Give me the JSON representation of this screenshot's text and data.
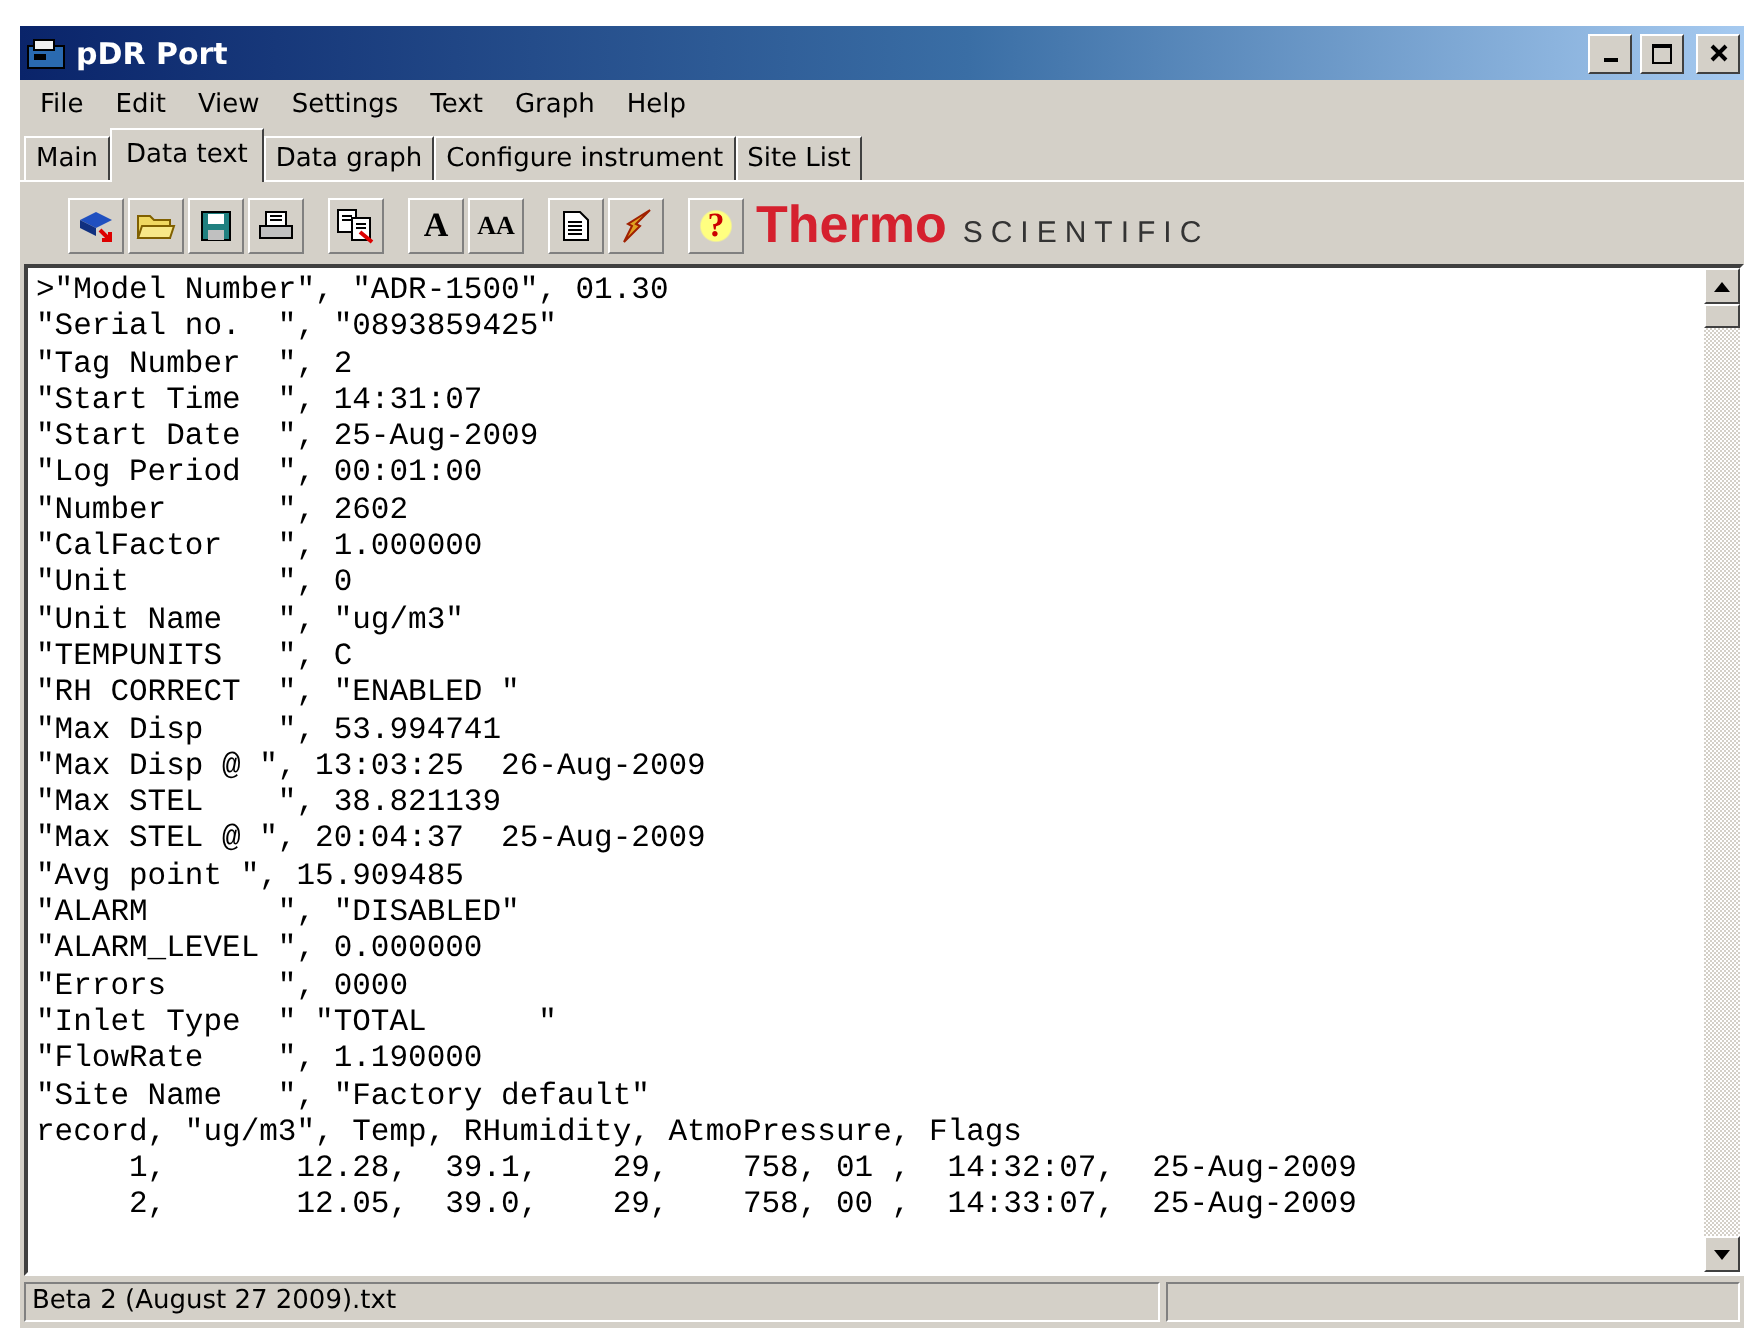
{
  "window": {
    "title": "pDR Port"
  },
  "menu": [
    "File",
    "Edit",
    "View",
    "Settings",
    "Text",
    "Graph",
    "Help"
  ],
  "tabs": [
    {
      "label": "Main",
      "selected": false
    },
    {
      "label": "Data text",
      "selected": true
    },
    {
      "label": "Data graph",
      "selected": false
    },
    {
      "label": "Configure instrument",
      "selected": false
    },
    {
      "label": "Site List",
      "selected": false
    }
  ],
  "toolbar": [
    {
      "kind": "download"
    },
    {
      "kind": "open"
    },
    {
      "kind": "save"
    },
    {
      "kind": "print"
    },
    {
      "kind": "sep"
    },
    {
      "kind": "copy"
    },
    {
      "kind": "sep"
    },
    {
      "kind": "font",
      "label": "A"
    },
    {
      "kind": "fontsize",
      "label": "AA"
    },
    {
      "kind": "sep"
    },
    {
      "kind": "document"
    },
    {
      "kind": "probe"
    },
    {
      "kind": "sep"
    },
    {
      "kind": "help",
      "label": "?"
    }
  ],
  "logo": {
    "brand": "Thermo",
    "subtitle": "SCIENTIFIC"
  },
  "text_lines": [
    ">\"Model Number\", \"ADR-1500\", 01.30",
    "\"Serial no.  \", \"0893859425\"",
    "\"Tag Number  \", 2",
    "\"Start Time  \", 14:31:07",
    "\"Start Date  \", 25-Aug-2009",
    "\"Log Period  \", 00:01:00",
    "\"Number      \", 2602",
    "\"CalFactor   \", 1.000000",
    "\"Unit        \", 0",
    "\"Unit Name   \", \"ug/m3\"",
    "\"TEMPUNITS   \", C",
    "\"RH CORRECT  \", \"ENABLED \"",
    "\"Max Disp    \", 53.994741",
    "\"Max Disp @ \", 13:03:25  26-Aug-2009",
    "\"Max STEL    \", 38.821139",
    "\"Max STEL @ \", 20:04:37  25-Aug-2009",
    "\"Avg point \", 15.909485",
    "\"ALARM       \", \"DISABLED\"",
    "\"ALARM_LEVEL \", 0.000000",
    "\"Errors      \", 0000",
    "\"Inlet Type  \" \"TOTAL      \"",
    "\"FlowRate    \", 1.190000",
    "\"Site Name   \", \"Factory default\"",
    "record, \"ug/m3\", Temp, RHumidity, AtmoPressure, Flags",
    "     1,       12.28,  39.1,    29,    758, 01 ,  14:32:07,  25-Aug-2009",
    "     2,       12.05,  39.0,    29,    758, 00 ,  14:33:07,  25-Aug-2009"
  ],
  "status_bar": {
    "file": "Beta 2 (August 27 2009).txt"
  }
}
